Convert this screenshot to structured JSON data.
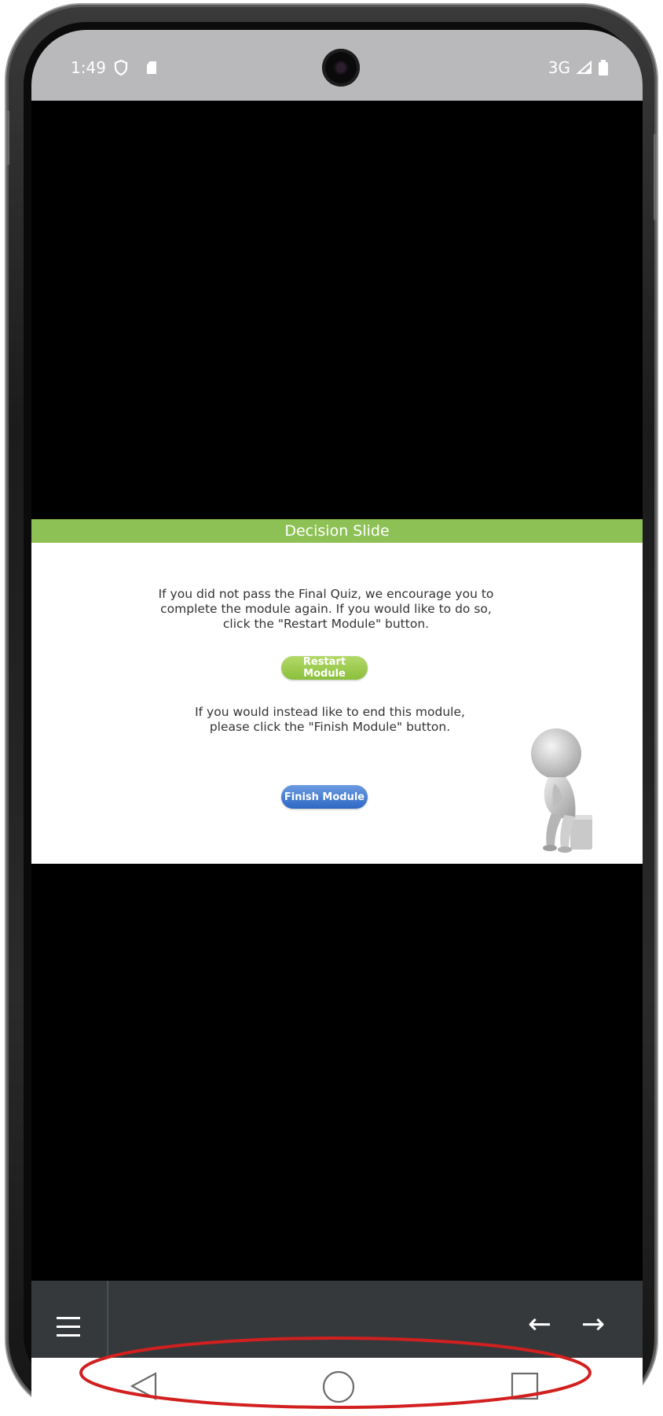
{
  "status_bar": {
    "time": "1:49",
    "network": "3G"
  },
  "slide": {
    "header_title": "Decision Slide",
    "paragraph_restart": "If you did not pass the Final Quiz, we encourage you to complete the module again. If you would like to do so, click the \"Restart Module\" button.",
    "restart_button_label": "Restart Module",
    "paragraph_finish": "If you would instead like to end this module, please click the \"Finish Module\" button.",
    "finish_button_label": "Finish Module"
  },
  "player_bar": {
    "menu_icon": "menu-icon",
    "prev_icon": "arrow-left-icon",
    "next_icon": "arrow-right-icon"
  },
  "nav_bar": {
    "back_icon": "triangle-back-icon",
    "home_icon": "circle-home-icon",
    "recent_icon": "square-recents-icon"
  },
  "colors": {
    "header_green": "#8dc155",
    "restart_green": "#8bbf3c",
    "finish_blue": "#2e68c4",
    "player_bar": "#35393c",
    "status_bar": "#b9b9bb",
    "annotation_red": "#d21f1f"
  }
}
